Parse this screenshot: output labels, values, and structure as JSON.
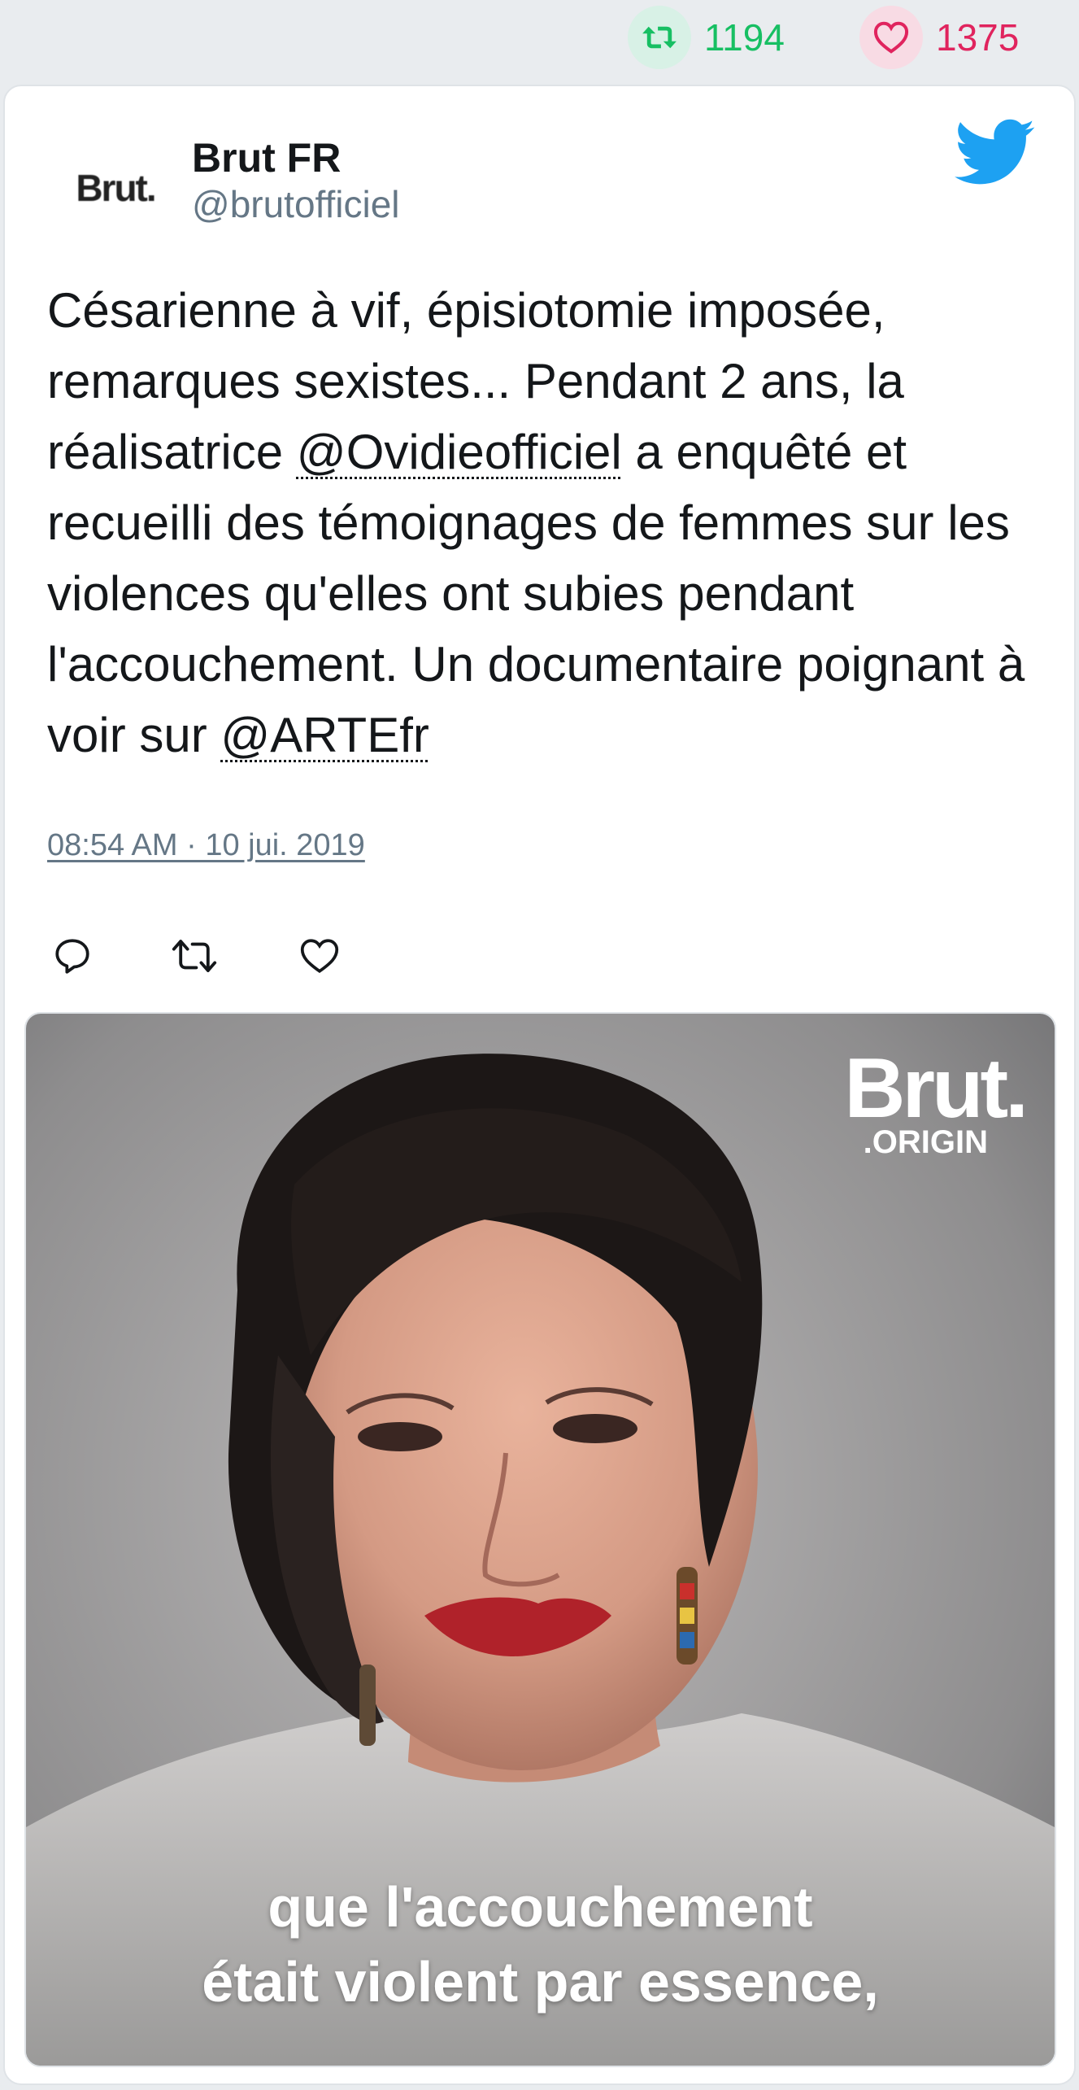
{
  "stats": {
    "retweet_count": "1194",
    "like_count": "1375"
  },
  "tweet": {
    "display_name": "Brut FR",
    "handle": "@brutofficiel",
    "avatar_text": "Brut.",
    "text_parts": {
      "before_mention_1": "Césarienne à vif, épisiotomie imposée, remarques sexistes... Pendant 2 ans, la réalisatrice ",
      "mention_1": "@Ovidieofficiel",
      "between_mentions": " a enquêté et recueilli des témoignages de femmes sur les violences qu'elles ont subies pendant l'accouchement. Un documentaire poignant à voir sur ",
      "mention_2": "@ARTEfr"
    },
    "timestamp": "08:54 AM · 10 jui. 2019"
  },
  "media": {
    "logo_main": "Brut.",
    "logo_sub": ".ORIGIN",
    "caption_line_1": "que l'accouchement",
    "caption_line_2": "était violent par essence,"
  },
  "icons": {
    "twitter_bird": "twitter-bird-icon",
    "reply": "reply-icon",
    "retweet": "retweet-icon",
    "like": "heart-icon"
  },
  "colors": {
    "twitter_blue": "#1da1f2",
    "retweet_green": "#17bf63",
    "like_pink": "#e0245e",
    "secondary_text": "#657786"
  }
}
